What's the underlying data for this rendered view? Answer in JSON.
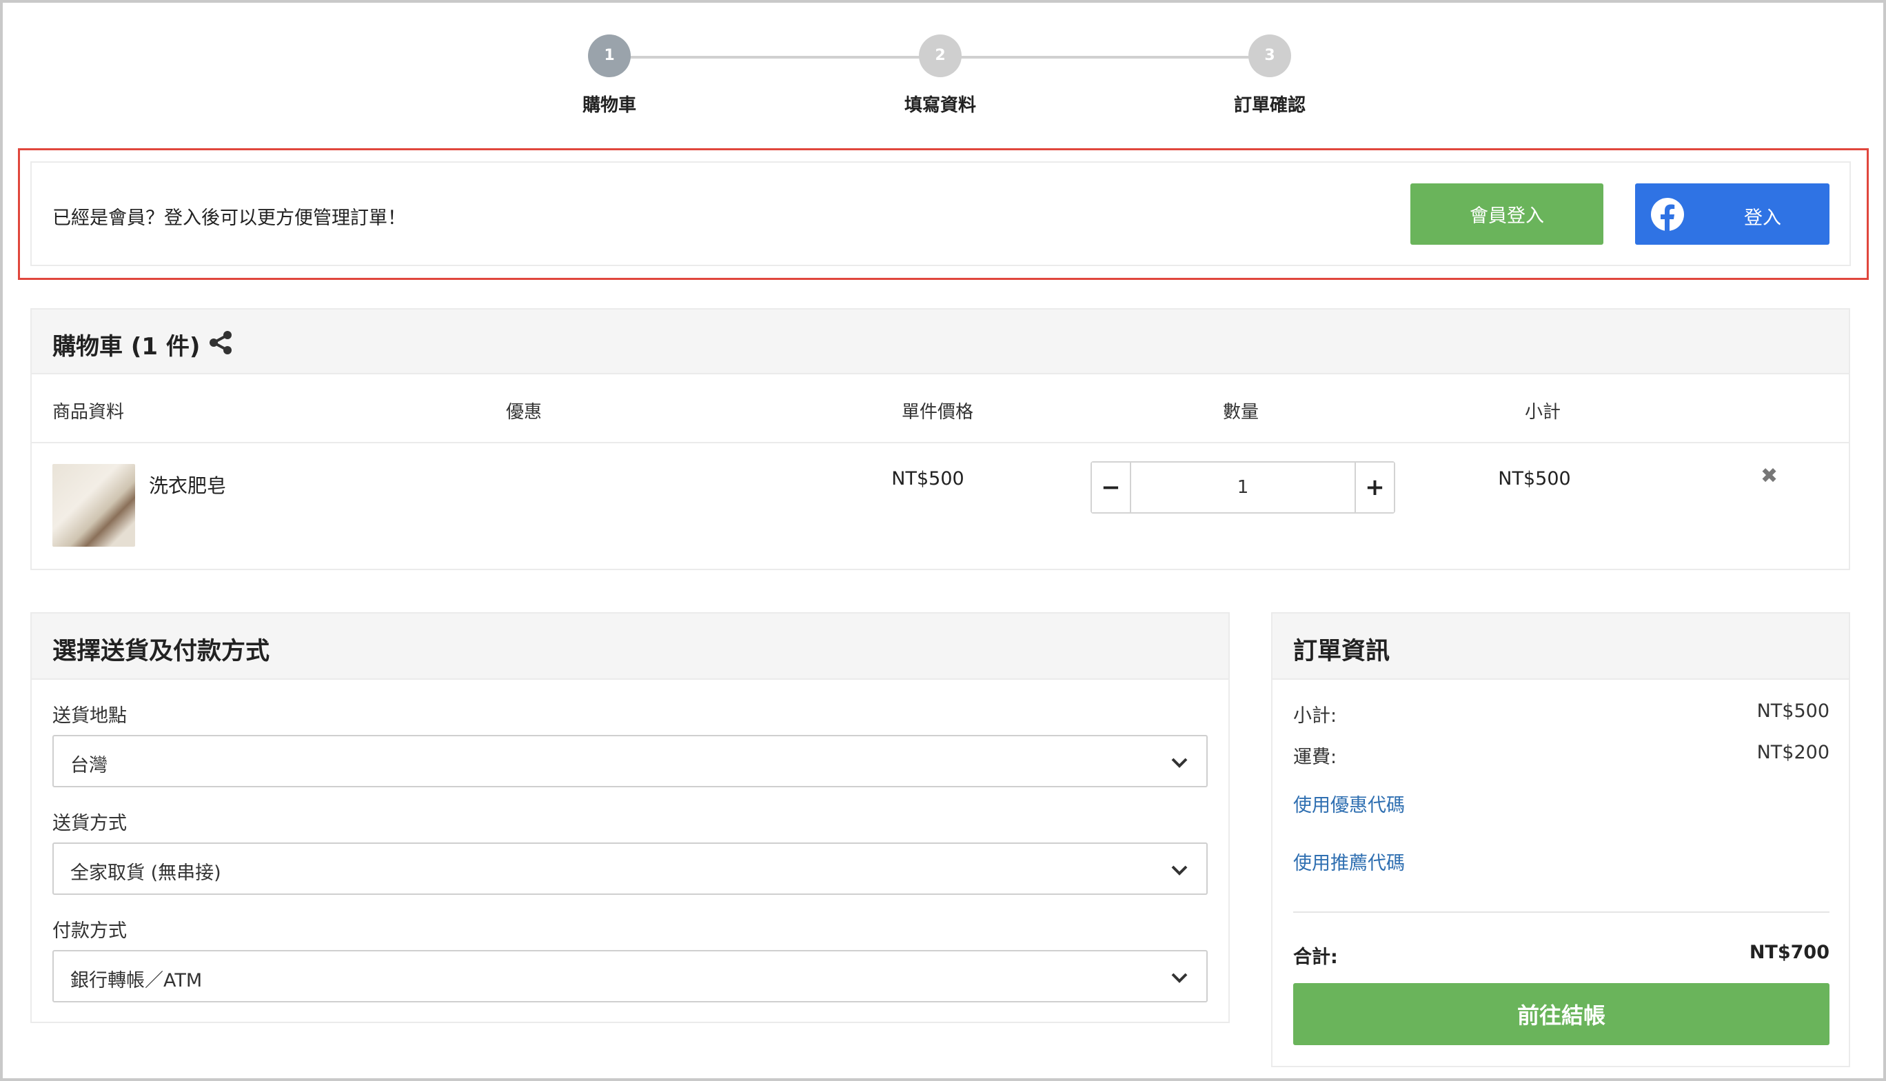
{
  "steps": [
    {
      "number": "1",
      "label": "購物車",
      "active": true
    },
    {
      "number": "2",
      "label": "填寫資料",
      "active": false
    },
    {
      "number": "3",
      "label": "訂單確認",
      "active": false
    }
  ],
  "login": {
    "prompt": "已經是會員？登入後可以更方便管理訂單！",
    "member_button": "會員登入",
    "facebook_button": "登入"
  },
  "cart": {
    "title": "購物車 (1 件)",
    "columns": {
      "product": "商品資料",
      "discount": "優惠",
      "unit_price": "單件價格",
      "quantity": "數量",
      "subtotal": "小計"
    },
    "items": [
      {
        "name": "洗衣肥皂",
        "unit_price": "NT$500",
        "quantity": "1",
        "subtotal": "NT$500"
      }
    ],
    "remove_icon": "✖"
  },
  "shipping": {
    "title": "選擇送貨及付款方式",
    "location_label": "送貨地點",
    "location_value": "台灣",
    "method_label": "送貨方式",
    "method_value": "全家取貨 (無串接)",
    "payment_label": "付款方式",
    "payment_value": "銀行轉帳／ATM"
  },
  "order": {
    "title": "訂單資訊",
    "subtotal_label": "小計:",
    "subtotal_value": "NT$500",
    "shipping_label": "運費:",
    "shipping_value": "NT$200",
    "coupon_link": "使用優惠代碼",
    "referral_link": "使用推薦代碼",
    "total_label": "合計:",
    "total_value": "NT$700",
    "checkout_button": "前往結帳"
  },
  "colors": {
    "accent_green": "#6ab45b",
    "facebook_blue": "#2f73e4",
    "highlight_red": "#e0473d",
    "link_blue": "#2f6fb1"
  }
}
